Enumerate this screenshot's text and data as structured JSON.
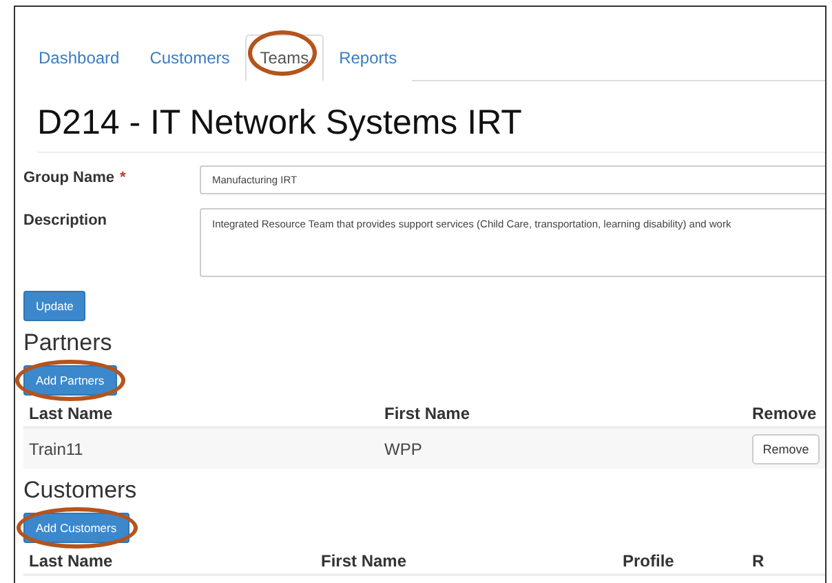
{
  "tabs": [
    {
      "label": "Dashboard",
      "selected": false,
      "annotated": false
    },
    {
      "label": "Customers",
      "selected": false,
      "annotated": false
    },
    {
      "label": "Teams",
      "selected": true,
      "annotated": true
    },
    {
      "label": "Reports",
      "selected": false,
      "annotated": false
    }
  ],
  "title": "D214 - IT Network Systems IRT",
  "form": {
    "fields": [
      {
        "label": "Group Name",
        "required_mark": "*",
        "kind": "input",
        "value": "Manufacturing IRT"
      },
      {
        "label": "Description",
        "kind": "textarea",
        "value": "Integrated Resource Team that provides support services (Child Care, transportation, learning disability) and work"
      }
    ],
    "submit": {
      "label": "Update",
      "annotated": false
    }
  },
  "partners": {
    "heading": "Partners",
    "add_button": {
      "label": "Add Partners",
      "annotated": true
    },
    "columns": [
      "Last Name",
      "First Name",
      "Remove"
    ],
    "rows": [
      {
        "last_name": "Train11",
        "first_name": "WPP",
        "action": "Remove"
      }
    ]
  },
  "customers": {
    "heading": "Customers",
    "add_button": {
      "label": "Add Customers",
      "annotated": true
    },
    "columns": [
      "Last Name",
      "First Name",
      "Profile",
      "R"
    ]
  }
}
